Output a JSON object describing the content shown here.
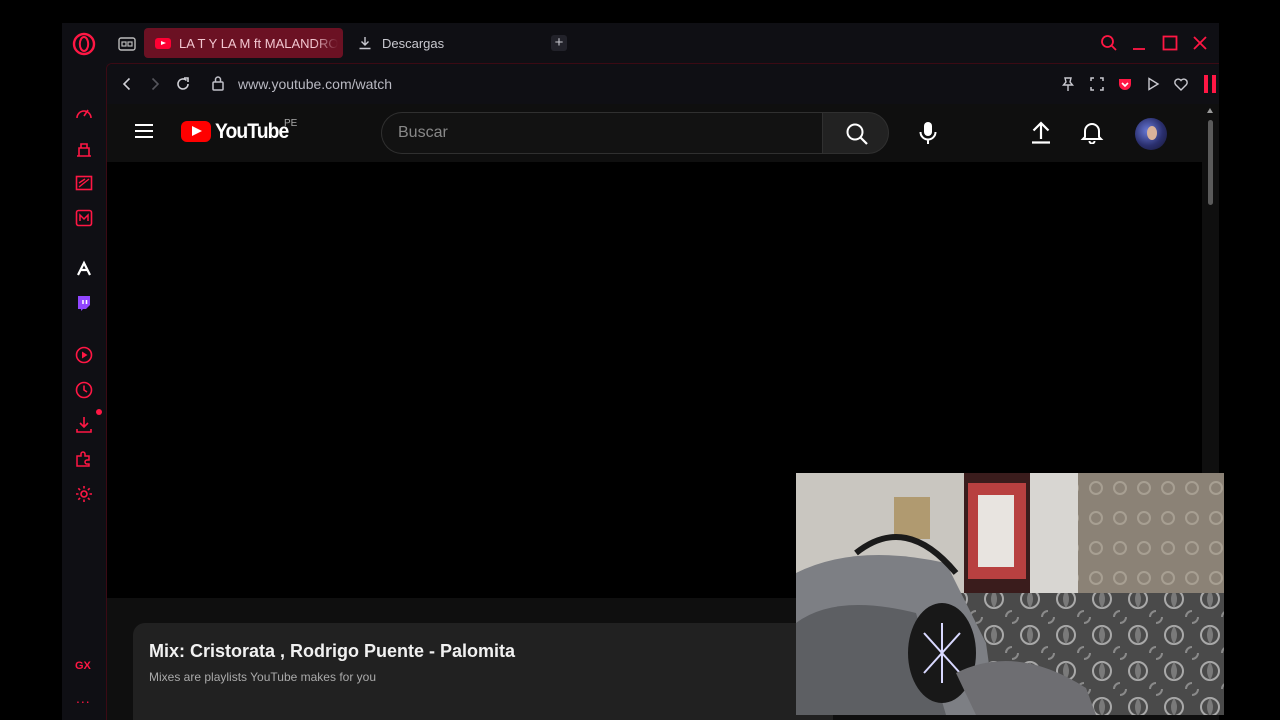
{
  "browser": {
    "tabs": [
      {
        "label": "LA T Y LA M ft MALANDRO",
        "active": true
      },
      {
        "label": "Descargas",
        "active": false
      }
    ],
    "new_tab_label": "+",
    "url": "www.youtube.com/watch",
    "accent_color": "#ff1744",
    "sidebar": {
      "items": [
        "speed-dial-icon",
        "gx-corner-icon",
        "news-icon",
        "messenger-icon",
        "aria-icon",
        "twitch-icon",
        "player-icon",
        "history-icon",
        "downloads-icon",
        "extensions-icon",
        "settings-icon"
      ],
      "gx_label": "GX",
      "more_label": "..."
    }
  },
  "youtube": {
    "logo_text": "YouTube",
    "country_code": "PE",
    "search_placeholder": "Buscar",
    "mix": {
      "title": "Mix: Cristorata , Rodrigo Puente - Palomita",
      "subtitle": "Mixes are playlists YouTube makes for you"
    }
  }
}
